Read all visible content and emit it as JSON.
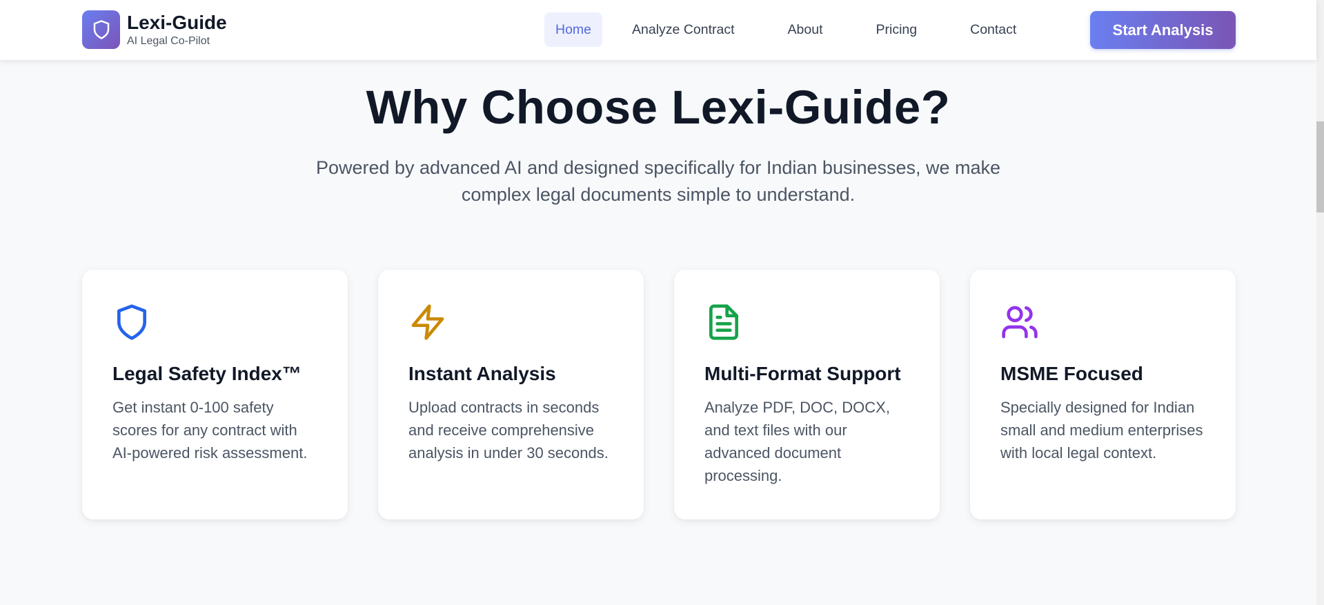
{
  "header": {
    "brand_name": "Lexi-Guide",
    "brand_tagline": "AI Legal Co-Pilot",
    "logo_icon": "shield-icon",
    "nav": {
      "home": "Home",
      "analyze": "Analyze Contract",
      "about": "About",
      "pricing": "Pricing",
      "contact": "Contact"
    },
    "active_nav": "Home",
    "cta_label": "Start Analysis"
  },
  "hero": {
    "title": "Why Choose Lexi-Guide?",
    "subtitle": "Powered by advanced AI and designed specifically for Indian businesses, we make complex legal documents simple to understand."
  },
  "features": [
    {
      "icon": "shield-icon",
      "icon_color": "#2563eb",
      "title": "Legal Safety Index™",
      "description": "Get instant 0-100 safety scores for any contract with AI-powered risk assessment."
    },
    {
      "icon": "lightning-icon",
      "icon_color": "#ca8a04",
      "title": "Instant Analysis",
      "description": "Upload contracts in seconds and receive comprehensive analysis in under 30 seconds."
    },
    {
      "icon": "document-icon",
      "icon_color": "#16a34a",
      "title": "Multi-Format Support",
      "description": "Analyze PDF, DOC, DOCX, and text files with our advanced document processing."
    },
    {
      "icon": "users-icon",
      "icon_color": "#9333ea",
      "title": "MSME Focused",
      "description": "Specially designed for Indian small and medium enterprises with local legal context."
    }
  ],
  "theme": {
    "accent": "#6a7ff0",
    "accent_end": "#7a55b5",
    "background": "#f8f9fb"
  }
}
